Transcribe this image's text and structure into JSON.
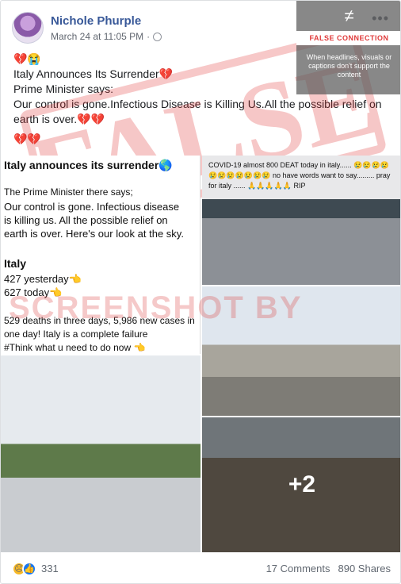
{
  "post": {
    "author": "Nichole Phurple",
    "timestamp": "March 24 at 11:05 PM",
    "text_lines": [
      "💔😭",
      "Italy Announces Its Surrender💔",
      "Prime Minister says:",
      "Our control is gone.Infectious Disease is Killing Us.All the possible relief on earth is over.💔💔",
      "💔💔"
    ]
  },
  "fact_check": {
    "title": "FALSE CONNECTION",
    "description": "When headlines, visuals or captions don't support the content",
    "stamp_text": "FALSE",
    "watermark": "SCREENSHOT BY"
  },
  "media": {
    "screenshot_lines": [
      "Italy announces its surrender🌎",
      "The Prime Minister there says;",
      "Our control is gone. Infectious disease",
      "is killing us.  All the possible relief on",
      "earth is over. Here's our look at the sky.",
      "Italy",
      "427 yesterday👈",
      "627 today👈",
      "529 deaths in three days, 5,986 new cases in",
      "one day!  Italy is a complete failure",
      "#Think what u need to do now 👈"
    ],
    "tile2_caption": "COVID-19 almost 800 DEAT today in italy...... 😢😢😢😢😢😢😢😢😢😢😢 no have words want to say......... pray for italy ...... 🙏🙏🙏🙏🙏 RIP",
    "more_count": "+2"
  },
  "footer": {
    "reaction_count": "331",
    "comments": "17 Comments",
    "shares": "890 Shares"
  },
  "colors": {
    "author_link": "#385898",
    "false_red": "#e03a3a"
  }
}
